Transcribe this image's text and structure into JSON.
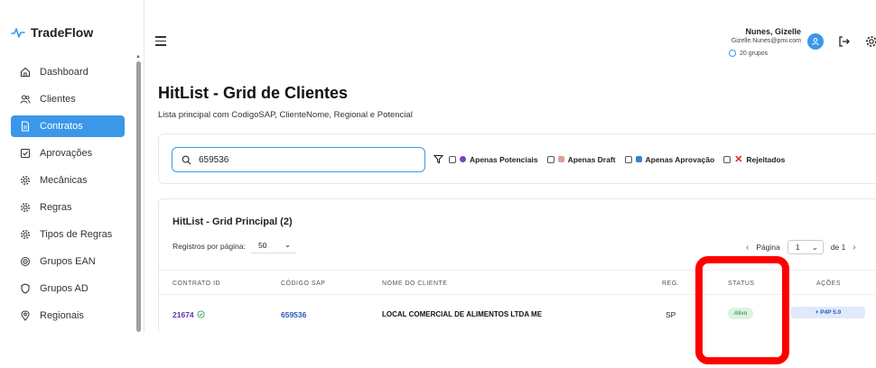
{
  "app": {
    "name": "TradeFlow"
  },
  "sidebar": {
    "items": [
      {
        "label": "Dashboard",
        "icon": "home-icon",
        "active": false
      },
      {
        "label": "Clientes",
        "icon": "users-icon",
        "active": false
      },
      {
        "label": "Contratos",
        "icon": "file-icon",
        "active": true
      },
      {
        "label": "Aprovações",
        "icon": "check-square-icon",
        "active": false
      },
      {
        "label": "Mecânicas",
        "icon": "gear-icon",
        "active": false
      },
      {
        "label": "Regras",
        "icon": "gear-icon",
        "active": false
      },
      {
        "label": "Tipos de Regras",
        "icon": "gear-icon",
        "active": false
      },
      {
        "label": "Grupos EAN",
        "icon": "target-icon",
        "active": false
      },
      {
        "label": "Grupos AD",
        "icon": "shield-icon",
        "active": false
      },
      {
        "label": "Regionais",
        "icon": "location-icon",
        "active": false
      }
    ]
  },
  "header": {
    "user_name": "Nunes, Gizelle",
    "user_email": "Gizelle.Nunes@pmi.com",
    "groups": "20 grupos"
  },
  "page": {
    "title": "HitList - Grid de Clientes",
    "subtitle": "Lista principal com CodigoSAP, ClienteNome, Regional e Potencial"
  },
  "filters": {
    "search_value": "659536",
    "options": [
      {
        "label": "Apenas Potenciais",
        "color": "#7b3fc4"
      },
      {
        "label": "Apenas Draft",
        "color": "#e0a090"
      },
      {
        "label": "Apenas Aprovação",
        "color": "#3b7fd8"
      },
      {
        "label": "Rejeitados",
        "color": "#e02020"
      }
    ]
  },
  "grid": {
    "title": "HitList - Grid Principal (2)",
    "per_page_label": "Registros por página:",
    "per_page_value": "50",
    "page_label": "Página",
    "page_value": "1",
    "page_of": "de 1",
    "columns": [
      "Contrato ID",
      "Código SAP",
      "Nome do Cliente",
      "Reg.",
      "Status",
      "Ações"
    ],
    "rows": [
      {
        "contrato_id": "21674",
        "codigo_sap": "659536",
        "cliente": "LOCAL COMERCIAL DE ALIMENTOS LTDA ME",
        "regional": "SP",
        "status": "Ativo",
        "acao": "+ P4P 5.0"
      }
    ]
  },
  "colors": {
    "accent": "#3b97e8",
    "highlight": "#ff0000",
    "status_bg": "#dbf3e0"
  }
}
